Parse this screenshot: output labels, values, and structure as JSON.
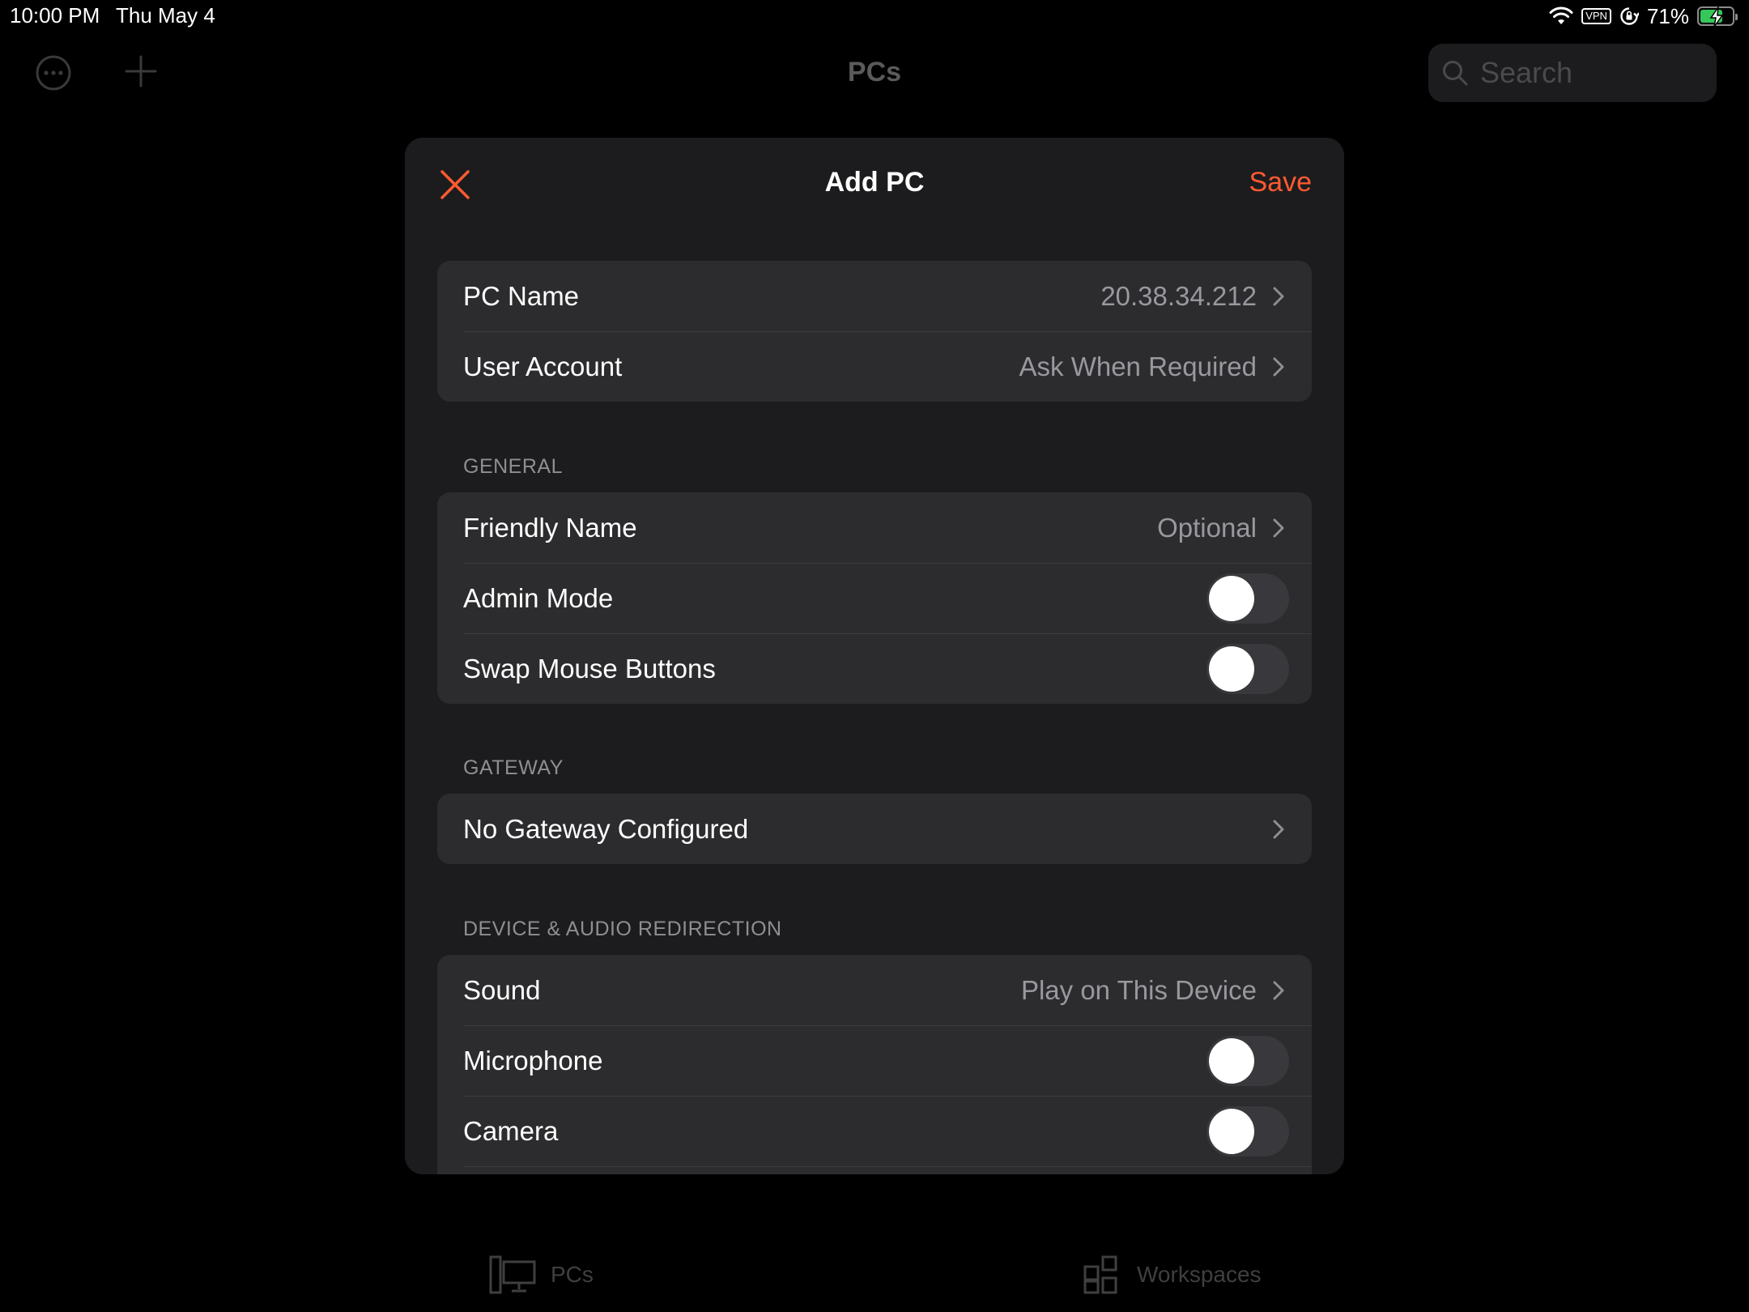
{
  "status_bar": {
    "time": "10:00 PM",
    "date": "Thu May 4",
    "vpn": "VPN",
    "battery": "71%",
    "battery_level": 0.71,
    "icons": [
      "wifi-icon",
      "vpn-icon",
      "rotation-lock-icon",
      "battery-charging-icon"
    ]
  },
  "background": {
    "title": "PCs",
    "search_placeholder": "Search",
    "tabs": [
      {
        "label": "PCs",
        "icon": "pc-monitor-icon"
      },
      {
        "label": "Workspaces",
        "icon": "workspaces-grid-icon"
      }
    ]
  },
  "modal": {
    "title": "Add PC",
    "save_label": "Save",
    "accent_color": "#ff5a30",
    "top_group": [
      {
        "label": "PC Name",
        "value": "20.38.34.212"
      },
      {
        "label": "User Account",
        "value": "Ask When Required"
      }
    ],
    "general": {
      "title": "GENERAL",
      "friendly_name": {
        "label": "Friendly Name",
        "value": "Optional"
      },
      "admin_mode": {
        "label": "Admin Mode",
        "on": false
      },
      "swap_mouse": {
        "label": "Swap Mouse Buttons",
        "on": false
      }
    },
    "gateway": {
      "title": "GATEWAY",
      "label": "No Gateway Configured"
    },
    "device": {
      "title": "DEVICE & AUDIO REDIRECTION",
      "sound": {
        "label": "Sound",
        "value": "Play on This Device"
      },
      "microphone": {
        "label": "Microphone",
        "on": false
      },
      "camera": {
        "label": "Camera",
        "on": false
      }
    }
  }
}
